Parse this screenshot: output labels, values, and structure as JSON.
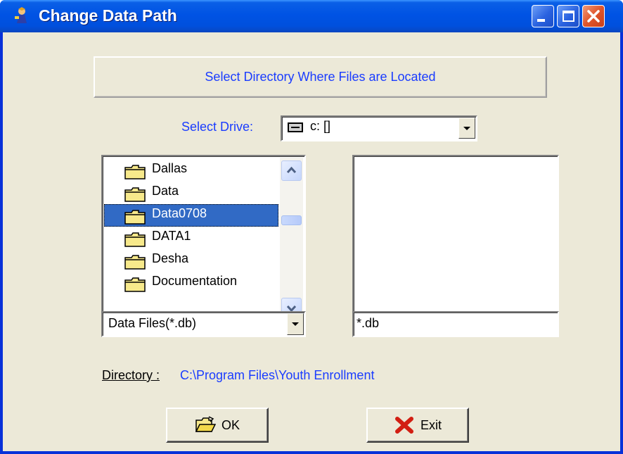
{
  "window": {
    "title": "Change Data Path"
  },
  "header": {
    "text": "Select Directory Where Files are Located"
  },
  "drive": {
    "label": "Select Drive:",
    "value": "c: []"
  },
  "folders": [
    {
      "name": "Dallas",
      "selected": false
    },
    {
      "name": "Data",
      "selected": false
    },
    {
      "name": "Data0708",
      "selected": true
    },
    {
      "name": "DATA1",
      "selected": false
    },
    {
      "name": "Desha",
      "selected": false
    },
    {
      "name": "Documentation",
      "selected": false
    }
  ],
  "file_type": {
    "value": "Data Files(*.db)"
  },
  "pattern": {
    "value": "*.db"
  },
  "directory": {
    "label": "Directory :",
    "value": "C:\\Program Files\\Youth Enrollment"
  },
  "buttons": {
    "ok_label": "OK",
    "exit_label": "Exit"
  },
  "colors": {
    "accent_text": "#1a3cff",
    "selection": "#316ac5",
    "titlebar": "#0053e4"
  }
}
